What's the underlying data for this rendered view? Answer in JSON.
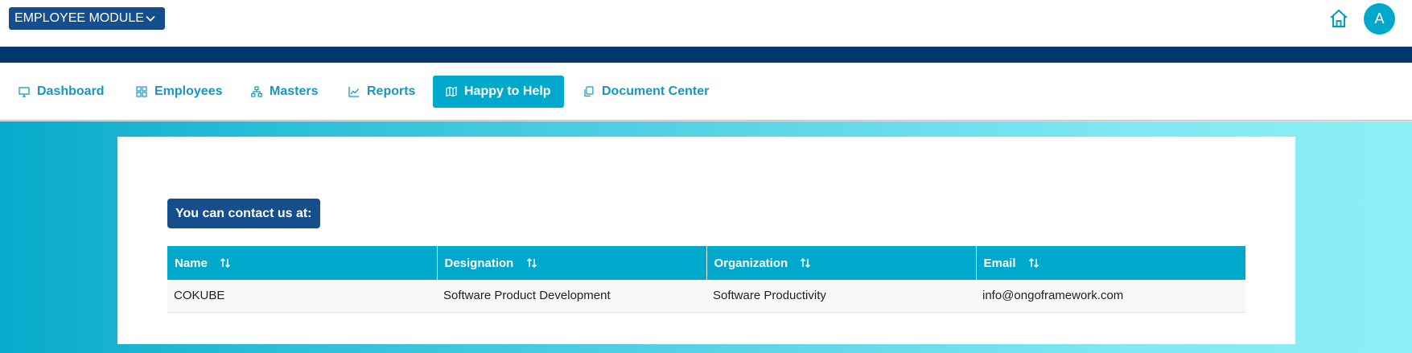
{
  "header": {
    "module_label": "EMPLOYEE MODULE",
    "avatar_initial": "A"
  },
  "nav": {
    "items": [
      {
        "label": "Dashboard",
        "icon": "monitor-icon"
      },
      {
        "label": "Employees",
        "icon": "grid-icon"
      },
      {
        "label": "Masters",
        "icon": "sitemap-icon"
      },
      {
        "label": "Reports",
        "icon": "chart-line-icon"
      },
      {
        "label": "Happy to Help",
        "icon": "map-icon"
      },
      {
        "label": "Document Center",
        "icon": "copy-icon"
      }
    ],
    "active": "Happy to Help"
  },
  "contact": {
    "heading": "You can contact us at:",
    "columns": [
      "Name",
      "Designation",
      "Organization",
      "Email"
    ],
    "rows": [
      [
        "COKUBE",
        "Software Product Development",
        "Software Productivity",
        "info@ongoframework.com"
      ]
    ]
  },
  "colors": {
    "primary_dark": "#144e8c",
    "navy_band": "#00386e",
    "accent": "#00a8cc",
    "link": "#1796c1"
  }
}
